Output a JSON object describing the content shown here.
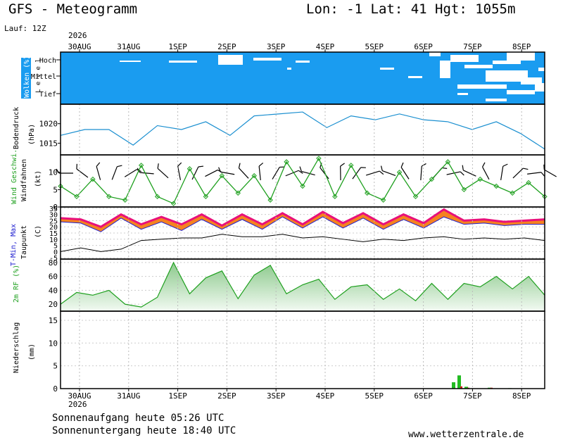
{
  "header": {
    "title": "GFS - Meteogramm",
    "location": "Lon: -1  Lat: 41  Hgt: 1055m",
    "run": "Lauf: 12Z",
    "year_top": "2026",
    "year_bottom": "2026"
  },
  "footer": {
    "sunrise": "Sonnenaufgang heute 05:26 UTC",
    "sunset": "Sonnenuntergang heute 18:40 UTC",
    "credit": "www.wetterzentrale.de"
  },
  "colors": {
    "cloud_blue": "#1a9cf0",
    "pressure_line": "#1a8fd0",
    "wind_line": "#1fa01f",
    "tmax_fill": "#f58220",
    "tmax_top": "#e8107a",
    "tmin_line": "#2020d0",
    "dewpoint_line": "#000000",
    "rh_line": "#1fa01f",
    "rh_fill": "#bfe3bf",
    "precip_green": "#22bb22",
    "precip_red": "#d02020"
  },
  "chart_data": [
    {
      "type": "heatmap",
      "name": "Wolken (%)",
      "ylabel": "Wolken (%)",
      "ylabel2": "L e v e l",
      "levels": [
        "Hoch",
        "Mittel",
        "Tief"
      ],
      "x": [
        "30AUG",
        "31AUG",
        "1SEP",
        "2SEP",
        "3SEP",
        "4SEP",
        "5SEP",
        "6SEP",
        "7SEP",
        "8SEP"
      ],
      "note_clear_periods": [
        "2SEP",
        "7SEP",
        "8SEP"
      ]
    },
    {
      "type": "line",
      "ylabel": "Bodendruck",
      "ylabel2": "(hPa)",
      "yticks": [
        1015,
        1020
      ],
      "ylim": [
        1012,
        1025
      ],
      "x": [
        "29AUG 12Z",
        "30AUG 00Z",
        "30AUG 12Z",
        "31AUG 00Z",
        "31AUG 12Z",
        "1SEP 00Z",
        "1SEP 12Z",
        "2SEP 00Z",
        "2SEP 12Z",
        "3SEP 00Z",
        "3SEP 12Z",
        "4SEP 00Z",
        "4SEP 12Z",
        "5SEP 00Z",
        "5SEP 12Z",
        "6SEP 00Z",
        "6SEP 12Z",
        "7SEP 00Z",
        "7SEP 12Z",
        "8SEP 00Z",
        "8SEP 12Z"
      ],
      "values": [
        1017,
        1018.5,
        1018.5,
        1014.5,
        1019.5,
        1018.5,
        1020.5,
        1017,
        1022,
        1022.5,
        1023,
        1019,
        1022,
        1021,
        1022.5,
        1021,
        1020.5,
        1018.5,
        1020.5,
        1017.5,
        1013.5
      ]
    },
    {
      "type": "line",
      "ylabel": "Wind Geschwi.",
      "ylabel2": "Windfahnen",
      "ylabel3": "(kt)",
      "yticks": [
        0,
        5,
        10
      ],
      "ylim": [
        0,
        15
      ],
      "values": [
        6,
        3,
        8,
        3,
        2,
        12,
        3,
        1,
        11,
        3,
        9,
        4,
        9,
        2,
        13,
        6,
        14,
        3,
        12,
        4,
        2,
        10,
        3,
        8,
        13,
        5,
        8,
        6,
        4,
        7,
        3
      ]
    },
    {
      "type": "area",
      "ylabel": "T-Min, Max",
      "ylabel2": "Taupunkt",
      "ylabel3": "(C)",
      "yticks": [
        -5,
        0,
        5,
        10,
        15,
        20,
        25,
        30,
        35
      ],
      "ylim": [
        -6,
        36
      ],
      "tmax": [
        27,
        26,
        20,
        30,
        22,
        28,
        22,
        30,
        21,
        30,
        22,
        31,
        22,
        32,
        23,
        31,
        22,
        30,
        23,
        34,
        25,
        26,
        24,
        25,
        26
      ],
      "tmin": [
        24,
        23,
        16,
        27,
        18,
        24,
        17,
        26,
        18,
        26,
        18,
        28,
        19,
        28,
        19,
        27,
        18,
        26,
        19,
        28,
        22,
        23,
        21,
        22,
        22
      ],
      "dewpoint": [
        0,
        3,
        0,
        2,
        9,
        10,
        11,
        11,
        14,
        12,
        12,
        14,
        11,
        12,
        10,
        8,
        10,
        9,
        11,
        12,
        10,
        11,
        10,
        11,
        9
      ]
    },
    {
      "type": "area",
      "ylabel": "2m RF (%)",
      "yticks": [
        20,
        40,
        60,
        80
      ],
      "ylim": [
        10,
        85
      ],
      "values": [
        20,
        37,
        33,
        40,
        20,
        16,
        30,
        80,
        35,
        58,
        68,
        28,
        62,
        76,
        35,
        48,
        56,
        27,
        45,
        48,
        27,
        42,
        25,
        50,
        27,
        50,
        45,
        60,
        42,
        60,
        33
      ]
    },
    {
      "type": "bar",
      "ylabel": "Niederschlag",
      "ylabel2": "(mm)",
      "yticks": [
        0,
        5,
        10,
        15
      ],
      "ylim": [
        0,
        17
      ],
      "green_bars": [
        [
          "6SEP 12Z",
          1.4
        ],
        [
          "6SEP 18Z",
          2.9
        ],
        [
          "7SEP 00Z",
          0.4
        ],
        [
          "7SEP 12Z",
          0.2
        ],
        [
          "8SEP 00Z",
          0.1
        ]
      ],
      "red_bars": [
        [
          "6SEP 18Z",
          0.5
        ],
        [
          "7SEP 00Z",
          0.2
        ],
        [
          "7SEP 12Z",
          0.2
        ]
      ]
    }
  ],
  "x_labels": [
    "30AUG",
    "31AUG",
    "1SEP",
    "2SEP",
    "3SEP",
    "4SEP",
    "5SEP",
    "6SEP",
    "7SEP",
    "8SEP"
  ]
}
